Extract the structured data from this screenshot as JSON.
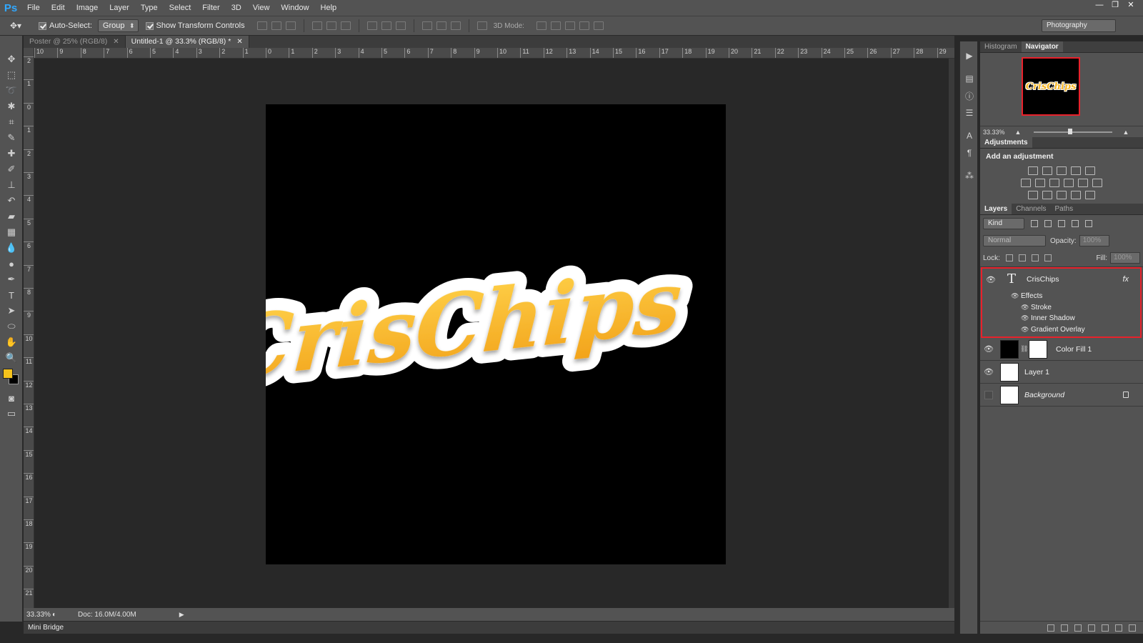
{
  "app": {
    "logo": "Ps"
  },
  "menu": [
    "File",
    "Edit",
    "Image",
    "Layer",
    "Type",
    "Select",
    "Filter",
    "3D",
    "View",
    "Window",
    "Help"
  ],
  "window_controls": [
    "—",
    "❐",
    "✕"
  ],
  "options": {
    "auto_select_label": "Auto-Select:",
    "auto_select_value": "Group",
    "transform_controls_label": "Show Transform Controls",
    "mode3d_label": "3D Mode:",
    "workspace": "Photography"
  },
  "tabs": [
    {
      "label": "Poster @ 25% (RGB/8)",
      "active": false
    },
    {
      "label": "Untitled-1 @ 33.3% (RGB/8) *",
      "active": true
    }
  ],
  "ruler_h": [
    "10",
    "9",
    "8",
    "7",
    "6",
    "5",
    "4",
    "3",
    "2",
    "1",
    "0",
    "1",
    "2",
    "3",
    "4",
    "5",
    "6",
    "7",
    "8",
    "9",
    "10",
    "11",
    "12",
    "13",
    "14",
    "15",
    "16",
    "17",
    "18",
    "19",
    "20",
    "21",
    "22",
    "23",
    "24",
    "25",
    "26",
    "27",
    "28",
    "29"
  ],
  "ruler_v": [
    "2",
    "1",
    "0",
    "1",
    "2",
    "3",
    "4",
    "5",
    "6",
    "7",
    "8",
    "9",
    "10",
    "11",
    "12",
    "13",
    "14",
    "15",
    "16",
    "17",
    "18",
    "19",
    "20",
    "21"
  ],
  "canvas": {
    "text": "CrisChips",
    "fill_top": "#ffd24a",
    "fill_bottom": "#f2a21a",
    "stroke": "#ffffff"
  },
  "status": {
    "zoom": "33.33%",
    "doc": "Doc: 16.0M/4.00M"
  },
  "mini_bridge": "Mini Bridge",
  "navigator": {
    "tabs": [
      "Histogram",
      "Navigator"
    ],
    "active": "Navigator",
    "zoom": "33.33%",
    "thumb_text": "CrisChips"
  },
  "adjustments": {
    "tab": "Adjustments",
    "title": "Add an adjustment"
  },
  "layers_panel": {
    "tabs": [
      "Layers",
      "Channels",
      "Paths"
    ],
    "kind": "Kind",
    "blend_mode": "Normal",
    "opacity_label": "Opacity:",
    "opacity": "100%",
    "lock_label": "Lock:",
    "fill_label": "Fill:",
    "fill": "100%",
    "layers": [
      {
        "name": "CrisChips",
        "type": "text",
        "fx": "fx",
        "effects_label": "Effects",
        "effects": [
          "Stroke",
          "Inner Shadow",
          "Gradient Overlay"
        ]
      },
      {
        "name": "Color Fill 1",
        "type": "fill"
      },
      {
        "name": "Layer 1",
        "type": "pixel"
      },
      {
        "name": "Background",
        "type": "background"
      }
    ]
  },
  "colors": {
    "foreground": "#f5c31c",
    "background": "#000000",
    "highlight": "#e8212b"
  }
}
